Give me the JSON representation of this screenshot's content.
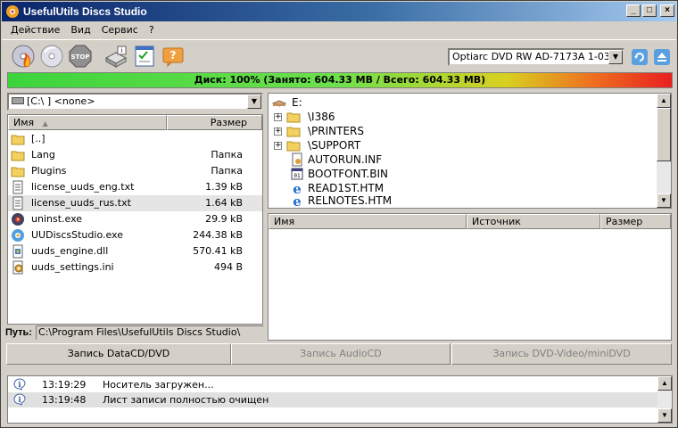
{
  "window": {
    "title": "UsefulUtils Discs Studio"
  },
  "menu": [
    "Действие",
    "Вид",
    "Сервис",
    "?"
  ],
  "toolbar": {
    "drive": "Optiarc DVD RW AD-7173A 1-03"
  },
  "capacity": {
    "text": "Диск: 100% (Занято: 604.33 MB / Всего: 604.33 MB)",
    "percent": 100
  },
  "left": {
    "combo": "[C:\\ ]  <none>",
    "columns": {
      "name": "Имя",
      "size": "Размер"
    },
    "files": [
      {
        "name": "[..]",
        "size": "",
        "icon": "folder-icon"
      },
      {
        "name": "Lang",
        "size": "Папка",
        "icon": "folder-icon"
      },
      {
        "name": "Plugins",
        "size": "Папка",
        "icon": "folder-icon"
      },
      {
        "name": "license_uuds_eng.txt",
        "size": "1.39 kB",
        "icon": "text-file-icon"
      },
      {
        "name": "license_uuds_rus.txt",
        "size": "1.64 kB",
        "icon": "text-file-icon"
      },
      {
        "name": "uninst.exe",
        "size": "29.9 kB",
        "icon": "uninstall-icon"
      },
      {
        "name": "UUDiscsStudio.exe",
        "size": "244.38 kB",
        "icon": "app-icon"
      },
      {
        "name": "uuds_engine.dll",
        "size": "570.41 kB",
        "icon": "dll-icon"
      },
      {
        "name": "uuds_settings.ini",
        "size": "494 B",
        "icon": "ini-icon"
      }
    ],
    "path_label": "Путь:",
    "path_value": "C:\\Program Files\\UsefulUtils Discs Studio\\"
  },
  "tree": {
    "root": "E:",
    "items": [
      {
        "label": "\\I386",
        "type": "folder"
      },
      {
        "label": "\\PRINTERS",
        "type": "folder"
      },
      {
        "label": "\\SUPPORT",
        "type": "folder"
      },
      {
        "label": "AUTORUN.INF",
        "type": "file"
      },
      {
        "label": "BOOTFONT.BIN",
        "type": "file"
      },
      {
        "label": "READ1ST.HTM",
        "type": "html"
      },
      {
        "label": "RELNOTES.HTM",
        "type": "html"
      }
    ]
  },
  "complist": {
    "columns": {
      "name": "Имя",
      "source": "Источник",
      "size": "Размер"
    }
  },
  "tabs": [
    "Запись DataCD/DVD",
    "Запись AudioCD",
    "Запись DVD-Video/miniDVD"
  ],
  "log": [
    {
      "time": "13:19:29",
      "msg": "Носитель загружен..."
    },
    {
      "time": "13:19:48",
      "msg": "Лист записи полностью очищен"
    }
  ]
}
